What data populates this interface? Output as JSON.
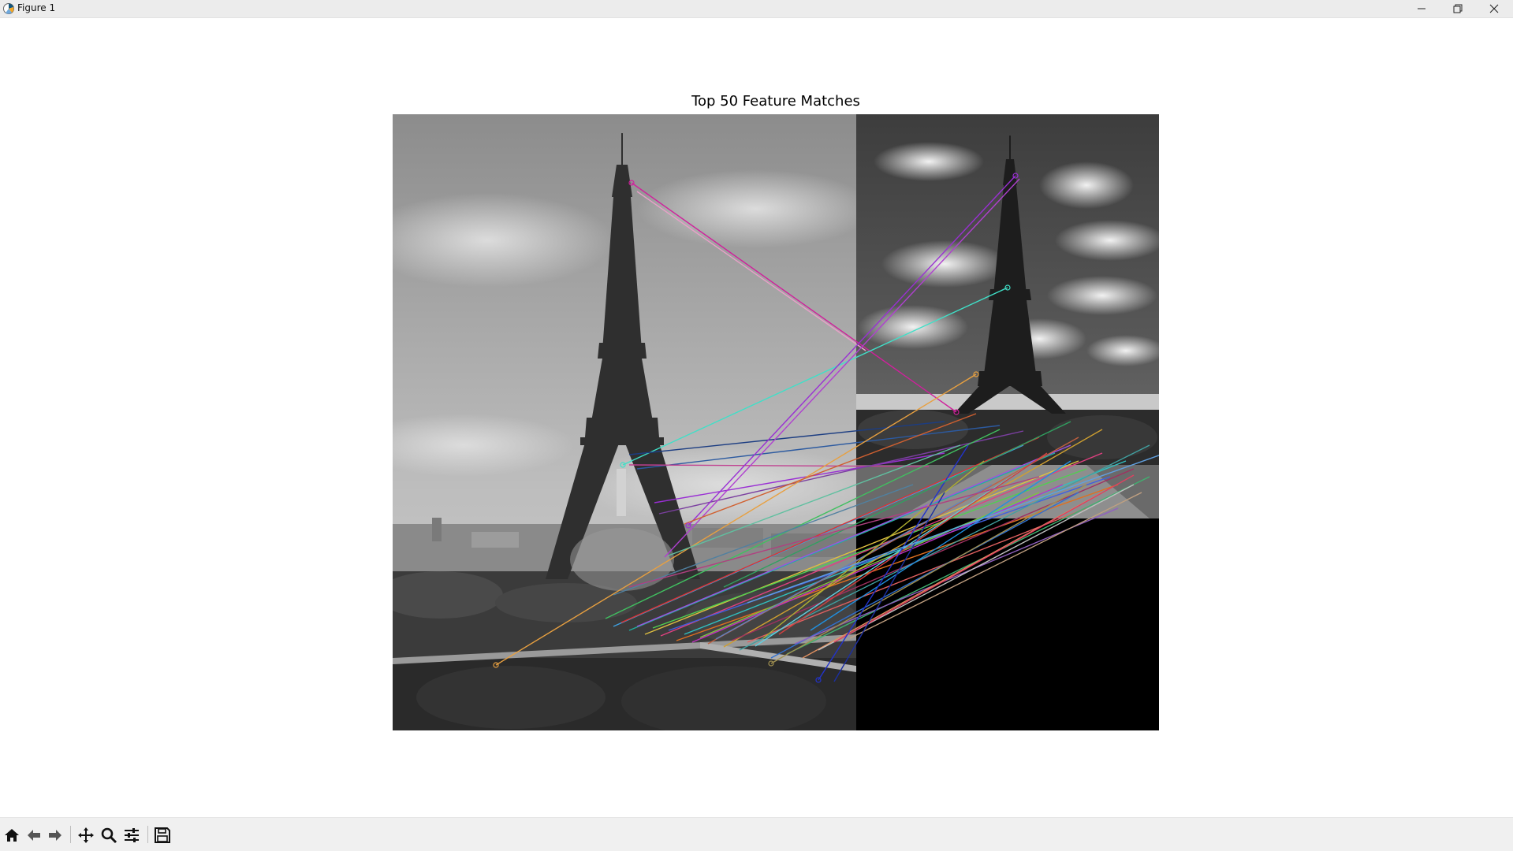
{
  "window": {
    "title": "Figure 1",
    "icons": [
      "matplotlib-app-icon",
      "minimize-icon",
      "maximize-icon",
      "close-icon"
    ]
  },
  "figure": {
    "title": "Top 50 Feature Matches",
    "match_count": 50,
    "colors": {
      "magenta": "#d0209c",
      "cyan": "#3fe0c8",
      "purple": "#9a2fd4",
      "navy": "#1c3d82",
      "blue": "#2233cc",
      "orange": "#e8a040",
      "red": "#e03030",
      "green": "#40c060",
      "olive": "#a09050"
    }
  },
  "toolbar": {
    "buttons": [
      {
        "name": "home-icon",
        "label": "Home"
      },
      {
        "name": "back-icon",
        "label": "Back"
      },
      {
        "name": "forward-icon",
        "label": "Forward"
      },
      {
        "name": "pan-icon",
        "label": "Pan"
      },
      {
        "name": "zoom-icon",
        "label": "Zoom"
      },
      {
        "name": "configure-subplots-icon",
        "label": "Configure subplots"
      },
      {
        "name": "save-icon",
        "label": "Save"
      }
    ]
  }
}
